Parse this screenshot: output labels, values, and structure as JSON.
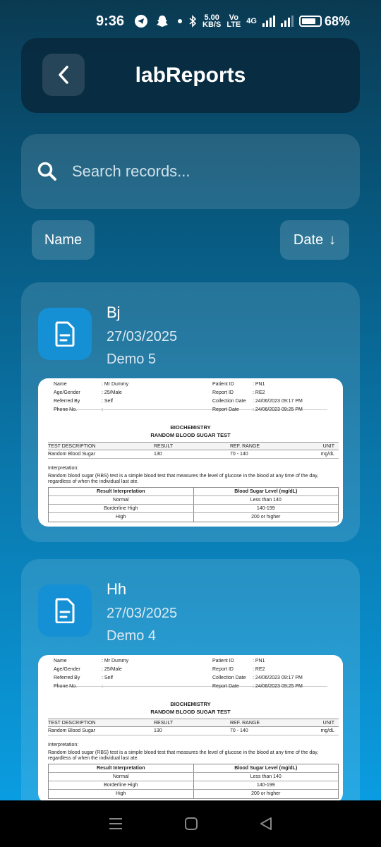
{
  "status_bar": {
    "time": "9:36",
    "net_speed_value": "5.00",
    "net_speed_unit": "KB/S",
    "volte_top": "Vo",
    "volte_bottom": "LTE",
    "network": "4G",
    "battery": "68%"
  },
  "header": {
    "title": "labReports"
  },
  "search": {
    "placeholder": "Search records..."
  },
  "sort": {
    "name_label": "Name",
    "date_label": "Date",
    "date_arrow": "↓"
  },
  "reports": [
    {
      "name": "Bj",
      "date": "27/03/2025",
      "subtitle": "Demo 5"
    },
    {
      "name": "Hh",
      "date": "27/03/2025",
      "subtitle": "Demo 4"
    }
  ],
  "preview": {
    "left_labels": [
      "Name",
      "Age/Gender",
      "Referred By",
      "Phone No."
    ],
    "left_values": [
      ": Mr Dummy",
      ": 25/Male",
      ": Self",
      ":"
    ],
    "right_labels": [
      "Patient ID",
      "Report ID",
      "Collection Date",
      "Report Date"
    ],
    "right_values": [
      ": PN1",
      ": RE2",
      ": 24/06/2023 09:17 PM",
      ": 24/06/2023 09:25 PM"
    ],
    "section": "BIOCHEMISTRY",
    "test_title": "RANDOM BLOOD SUGAR TEST",
    "table_headers": [
      "TEST DESCRIPTION",
      "RESULT",
      "REF. RANGE",
      "UNIT"
    ],
    "table_row": [
      "Random Blood Sugar",
      "130",
      "70 - 140",
      "mg/dL"
    ],
    "interpretation_label": "Interpretation:",
    "interpretation_text": "Random blood sugar (RBS) test is a simple blood test that measures the level of glucose in the blood at any time of the day, regardless of when the individual last ate.",
    "result_headers": [
      "Result Interpretation",
      "Blood Sugar Level (mg/dL)"
    ],
    "result_rows": [
      [
        "Normal",
        "Less than 140"
      ],
      [
        "Borderline High",
        "140-199"
      ],
      [
        "High",
        "200 or higher"
      ]
    ]
  }
}
